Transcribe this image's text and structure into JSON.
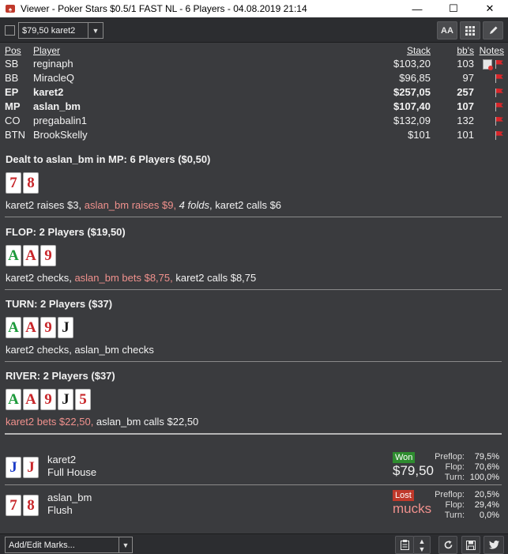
{
  "window": {
    "title": "Viewer - Poker Stars $0.5/1 FAST NL - 6 Players - 04.08.2019 21:14",
    "minimize": "—",
    "maximize": "☐",
    "close": "✕"
  },
  "toolbar": {
    "hand_select_value": "$79,50 karet2",
    "font_button": "AA"
  },
  "players_table": {
    "headers": {
      "pos": "Pos",
      "player": "Player",
      "stack": "Stack",
      "bb": "bb's",
      "notes": "Notes"
    },
    "rows": [
      {
        "pos": "SB",
        "player": "reginaph",
        "stack": "$103,20",
        "bb": "103"
      },
      {
        "pos": "BB",
        "player": "MiracleQ",
        "stack": "$96,85",
        "bb": "97"
      },
      {
        "pos": "EP",
        "player": "karet2",
        "stack": "$257,05",
        "bb": "257"
      },
      {
        "pos": "MP",
        "player": "aslan_bm",
        "stack": "$107,40",
        "bb": "107"
      },
      {
        "pos": "CO",
        "player": "pregabalin1",
        "stack": "$132,09",
        "bb": "132"
      },
      {
        "pos": "BTN",
        "player": "BrookSkelly",
        "stack": "$101",
        "bb": "101"
      }
    ]
  },
  "streets": {
    "preflop": {
      "heading": "Dealt to aslan_bm in MP: 6 Players ($0,50)",
      "cards": [
        "7",
        "8"
      ],
      "actions": {
        "a1": "karet2 raises $3, ",
        "a2": "aslan_bm raises $9, ",
        "a3": "4 folds",
        "a4": ", karet2 calls $6"
      }
    },
    "flop": {
      "heading": "FLOP: 2 Players ($19,50)",
      "cards": [
        "A",
        "A",
        "9"
      ],
      "actions": {
        "a1": "karet2 checks, ",
        "a2": "aslan_bm bets $8,75, ",
        "a3": "karet2 calls $8,75"
      }
    },
    "turn": {
      "heading": "TURN: 2 Players ($37)",
      "cards": [
        "A",
        "A",
        "9",
        "J"
      ],
      "actions": {
        "a1": "karet2 checks, aslan_bm checks"
      }
    },
    "river": {
      "heading": "RIVER: 2 Players ($37)",
      "cards": [
        "A",
        "A",
        "9",
        "J",
        "5"
      ],
      "actions": {
        "a1": "karet2 bets $22,50, ",
        "a2": "aslan_bm calls $22,50"
      }
    }
  },
  "results": [
    {
      "player": "karet2",
      "hand": "Full House",
      "cards": [
        "J",
        "J"
      ],
      "status": "Won",
      "amount": "$79,50",
      "stats": [
        {
          "label": "Preflop:",
          "value": "79,5%"
        },
        {
          "label": "Flop:",
          "value": "70,6%"
        },
        {
          "label": "Turn:",
          "value": "100,0%"
        }
      ]
    },
    {
      "player": "aslan_bm",
      "hand": "Flush",
      "cards": [
        "7",
        "8"
      ],
      "status": "Lost",
      "amount": "mucks",
      "stats": [
        {
          "label": "Preflop:",
          "value": "20,5%"
        },
        {
          "label": "Flop:",
          "value": "29,4%"
        },
        {
          "label": "Turn:",
          "value": "0,0%"
        }
      ]
    }
  ],
  "footer": {
    "marks_dropdown": "Add/Edit Marks..."
  },
  "colors": {
    "background": "#3a3b3e",
    "hero_action": "#f0918d",
    "won_badge": "#2e8c2f",
    "lost_badge": "#c0392b",
    "hearts": "#c8262a",
    "clubs": "#1d9a3b",
    "spades": "#1b1b1b",
    "diamonds": "#1c3bc8"
  }
}
